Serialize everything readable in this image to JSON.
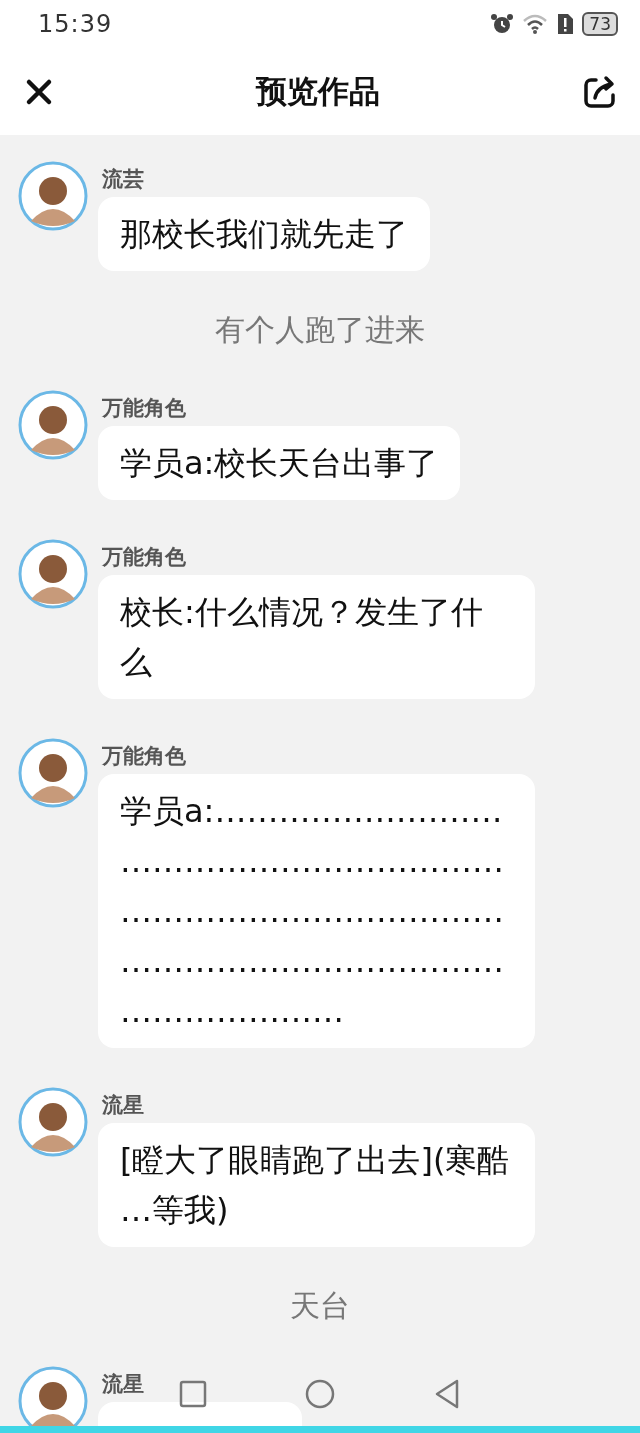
{
  "status_bar": {
    "time": "15:39",
    "battery": "73"
  },
  "header": {
    "title": "预览作品"
  },
  "items": [
    {
      "kind": "message",
      "name": "流芸",
      "text": "那校长我们就先走了"
    },
    {
      "kind": "narration",
      "text": "有个人跑了进来"
    },
    {
      "kind": "message",
      "name": "万能角色",
      "text": "学员a:校长天台出事了"
    },
    {
      "kind": "message",
      "name": "万能角色",
      "text": "校长:什么情况？发生了什么"
    },
    {
      "kind": "message",
      "name": "万能角色",
      "text": "学员a:…………………………………………………………………………………………………………………………………………"
    },
    {
      "kind": "message",
      "name": "流星",
      "text": "[瞪大了眼睛跑了出去](寒酷…等我)"
    },
    {
      "kind": "narration",
      "text": "天台"
    },
    {
      "kind": "message",
      "name": "流星"
    }
  ]
}
